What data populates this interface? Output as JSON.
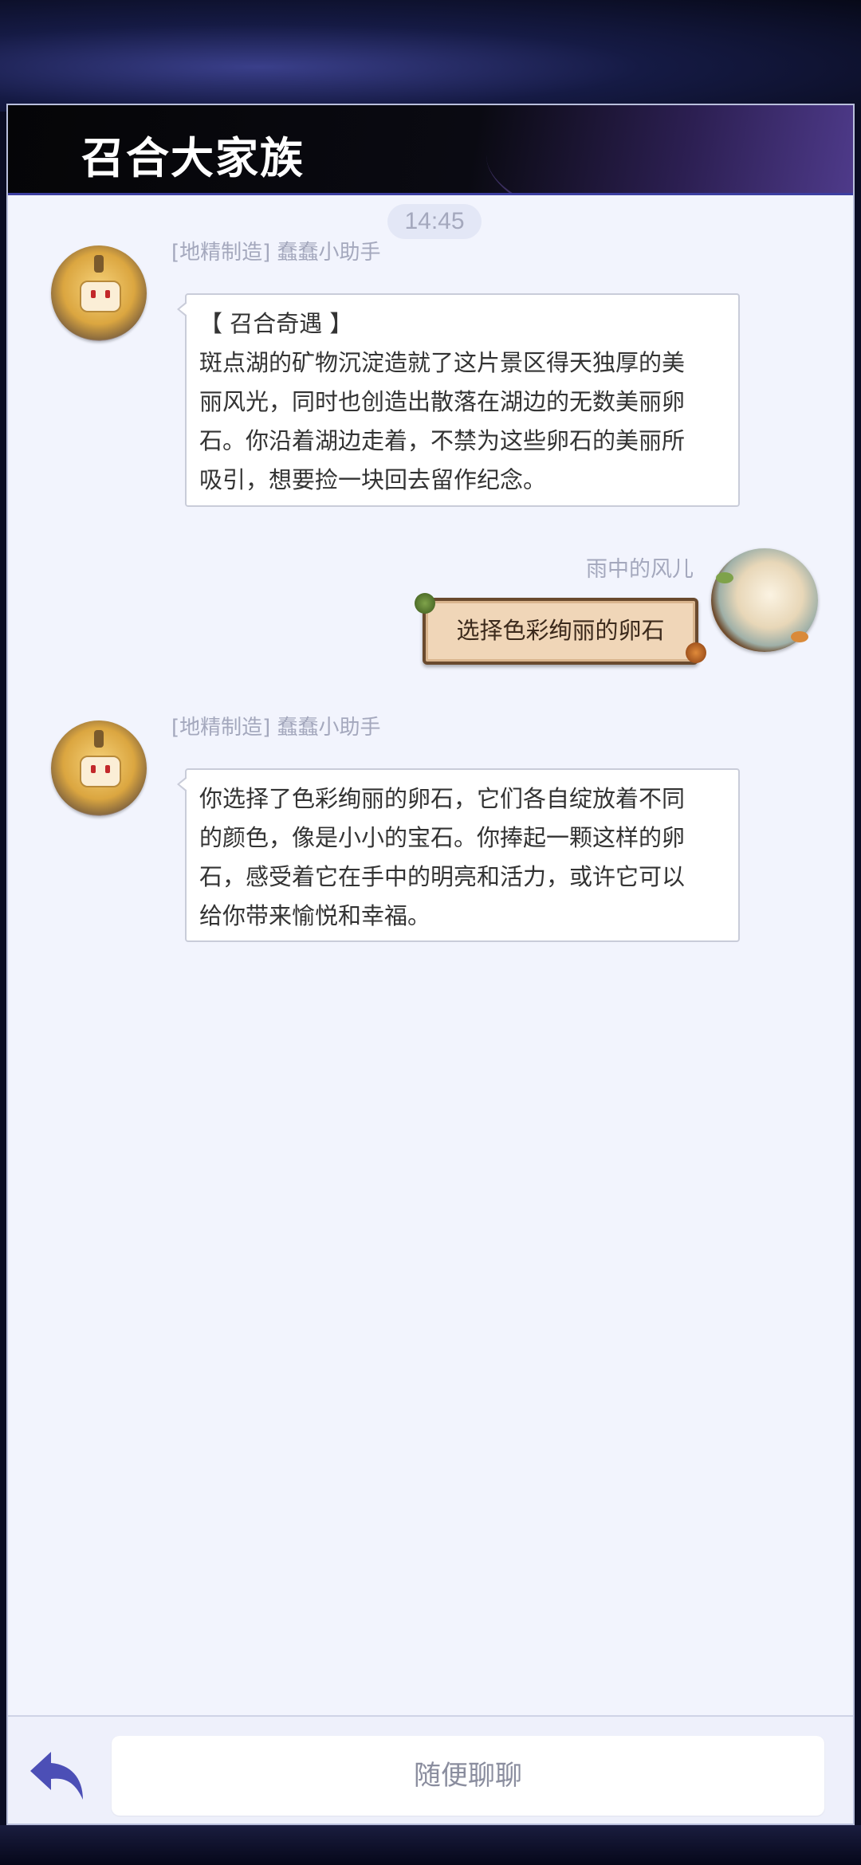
{
  "header": {
    "title": "召合大家族"
  },
  "chat": {
    "timestamp": "14:45",
    "messages": [
      {
        "sender": "[地精制造] 蠢蠢小助手",
        "lines": [
          "【 召合奇遇 】",
          "斑点湖的矿物沉淀造就了这片景区得天独厚的美",
          "丽风光，同时也创造出散落在湖边的无数美丽卵",
          "石。你沿着湖边走着，不禁为这些卵石的美丽所",
          "吸引，想要捡一块回去留作纪念。"
        ]
      },
      {
        "sender": "雨中的风儿",
        "text": "选择色彩绚丽的卵石"
      },
      {
        "sender": "[地精制造] 蠢蠢小助手",
        "lines": [
          "你选择了色彩绚丽的卵石，它们各自绽放着不同",
          "的颜色，像是小小的宝石。你捧起一颗这样的卵",
          "石，感受着它在手中的明亮和活力，或许它可以",
          "给你带来愉悦和幸福。"
        ]
      }
    ]
  },
  "footer": {
    "input_placeholder": "随便聊聊",
    "back_icon": "back-arrow-icon"
  },
  "colors": {
    "panel_bg": "#f2f4fd",
    "accent": "#4c4fb6",
    "muted_text": "#a4a8bd"
  }
}
